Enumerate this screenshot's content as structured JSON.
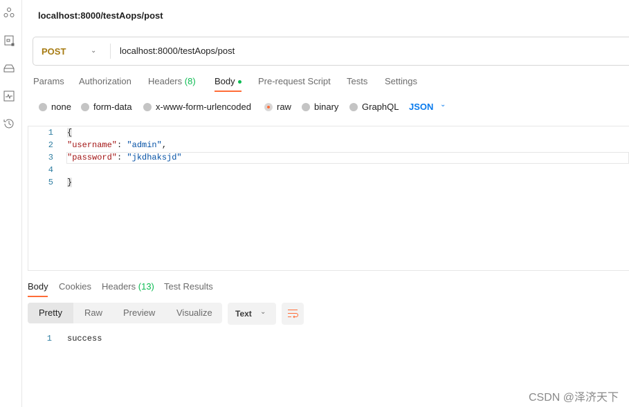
{
  "sidebar": {
    "icons": [
      "collections-icon",
      "environments-icon",
      "mock-servers-icon",
      "monitors-icon",
      "history-icon"
    ]
  },
  "title": "localhost:8000/testAops/post",
  "request": {
    "method": "POST",
    "url": "localhost:8000/testAops/post"
  },
  "request_tabs": {
    "params": "Params",
    "authorization": "Authorization",
    "headers": "Headers",
    "headers_count": "(8)",
    "body": "Body",
    "prerequest": "Pre-request Script",
    "tests": "Tests",
    "settings": "Settings"
  },
  "body_types": {
    "none": "none",
    "form_data": "form-data",
    "urlencoded": "x-www-form-urlencoded",
    "raw": "raw",
    "binary": "binary",
    "graphql": "GraphQL",
    "selected": "raw",
    "language": "JSON"
  },
  "editor": {
    "line_numbers": [
      "1",
      "2",
      "3",
      "4",
      "5"
    ],
    "open_brace": "{",
    "key1": "\"username\"",
    "val1": "\"admin\"",
    "key2": "\"password\"",
    "val2": "\"jkdhaksjd\"",
    "close_brace": "}",
    "colon": ": ",
    "comma": ","
  },
  "response_tabs": {
    "body": "Body",
    "cookies": "Cookies",
    "headers": "Headers",
    "headers_count": "(13)",
    "test_results": "Test Results"
  },
  "response_view": {
    "pretty": "Pretty",
    "raw": "Raw",
    "preview": "Preview",
    "visualize": "Visualize",
    "format": "Text"
  },
  "response": {
    "line": "1",
    "content": "success"
  },
  "colors": {
    "accent": "#ff6c37",
    "method": "#a77b12",
    "green": "#0cbb52",
    "link": "#097bed"
  },
  "watermark": "CSDN @泽济天下"
}
